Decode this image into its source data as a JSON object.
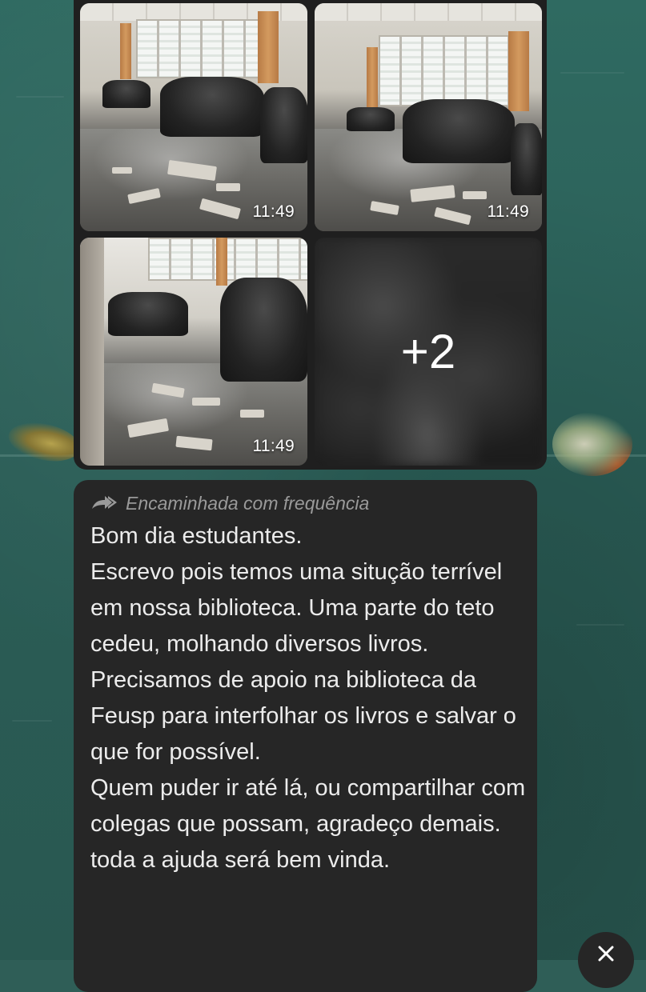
{
  "media_group": {
    "photos": [
      {
        "timestamp": "11:49"
      },
      {
        "timestamp": "11:49"
      },
      {
        "timestamp": "11:49"
      }
    ],
    "more_count": "+2"
  },
  "message": {
    "forwarded_label": "Encaminhada com frequência",
    "forward_icon": "double-arrow-forward-icon",
    "text": "Bom dia estudantes.\nEscrevo pois temos uma situção terrível em nossa biblioteca. Uma parte do teto cedeu, molhando diversos livros. Precisamos de apoio na biblioteca da Feusp para interfolhar os livros e salvar o que for possível.\nQuem puder ir até lá, ou compartilhar com colegas que possam, agradeço demais. toda a ajuda será bem vinda."
  },
  "close_button": {
    "icon": "close-icon"
  },
  "colors": {
    "bubble": "#262626",
    "text": "#ececec",
    "forwarded": "#9a9a9a",
    "wallpaper": "#2f5e57"
  }
}
